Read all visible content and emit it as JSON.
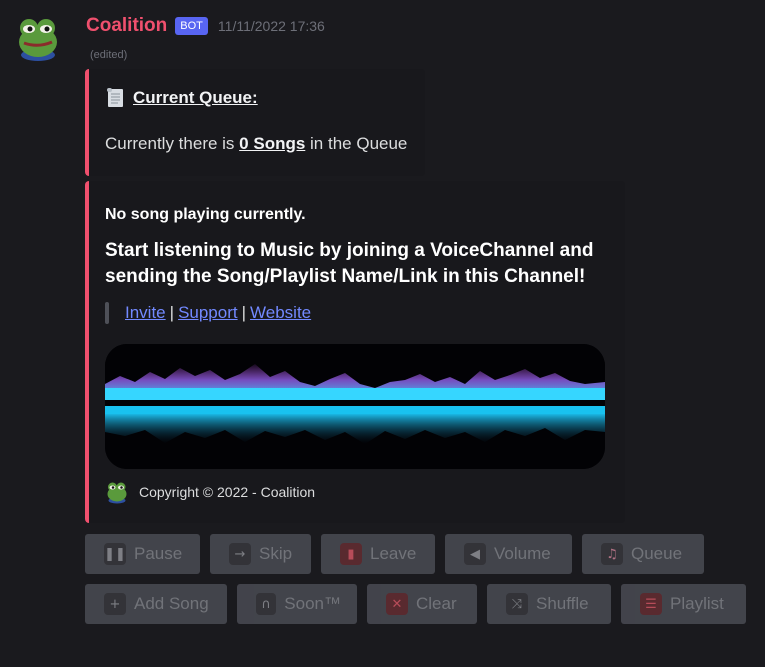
{
  "message": {
    "username": "Coalition",
    "bot_badge": "BOT",
    "timestamp": "11/11/2022 17:36",
    "edited": "(edited)"
  },
  "queue_embed": {
    "title": "Current Queue:",
    "desc_prefix": "Currently there is",
    "song_count": "0 Songs",
    "desc_suffix": "in the Queue"
  },
  "player_embed": {
    "title": "No song playing currently.",
    "description": "Start listening to Music by joining a VoiceChannel and sending the Song/Playlist Name/Link in this Channel!",
    "links": [
      "Invite",
      "Support",
      "Website"
    ],
    "separator": "|",
    "footer": "Copyright © 2022 - Coalition"
  },
  "buttons": {
    "pause": "Pause",
    "skip": "Skip",
    "leave": "Leave",
    "volume": "Volume",
    "queue": "Queue",
    "add_song": "Add Song",
    "soon": "Soon™",
    "clear": "Clear",
    "shuffle": "Shuffle",
    "playlist": "Playlist"
  },
  "icons": {
    "pause": "pause-icon",
    "skip": "skip-arrow-icon",
    "leave": "exit-door-icon",
    "volume": "speaker-icon",
    "queue": "music-note-icon",
    "add_song": "plus-icon",
    "soon": "headphones-icon",
    "clear": "x-icon",
    "shuffle": "shuffle-icon",
    "playlist": "list-icon"
  },
  "colors": {
    "accent": "#f0506e",
    "bot_badge": "#5865f2",
    "link": "#7289ff",
    "background": "#1a1a1e",
    "embed_bg": "#18181c",
    "button": "#4e5058"
  }
}
